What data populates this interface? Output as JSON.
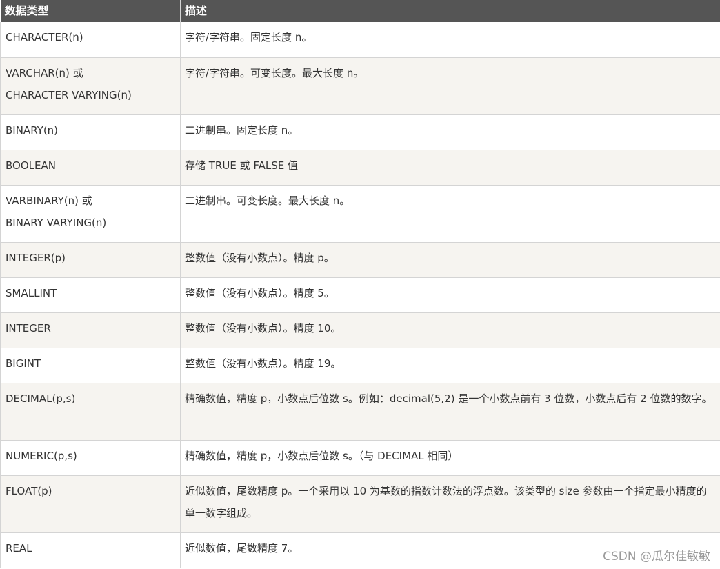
{
  "header": {
    "col_type": "数据类型",
    "col_desc": "描述"
  },
  "rows": [
    {
      "type": "CHARACTER(n)",
      "desc": "字符/字符串。固定长度 n。"
    },
    {
      "type": "VARCHAR(n) 或\nCHARACTER VARYING(n)",
      "desc": "字符/字符串。可变长度。最大长度 n。"
    },
    {
      "type": "BINARY(n)",
      "desc": "二进制串。固定长度 n。"
    },
    {
      "type": "BOOLEAN",
      "desc": "存储 TRUE 或 FALSE 值"
    },
    {
      "type": "VARBINARY(n) 或\nBINARY VARYING(n)",
      "desc": "二进制串。可变长度。最大长度 n。"
    },
    {
      "type": "INTEGER(p)",
      "desc": "整数值（没有小数点）。精度 p。"
    },
    {
      "type": "SMALLINT",
      "desc": "整数值（没有小数点）。精度 5。"
    },
    {
      "type": "INTEGER",
      "desc": "整数值（没有小数点）。精度 10。"
    },
    {
      "type": "BIGINT",
      "desc": "整数值（没有小数点）。精度 19。"
    },
    {
      "type": "DECIMAL(p,s)",
      "desc": "精确数值，精度 p，小数点后位数 s。例如：decimal(5,2) 是一个小数点前有 3 位数，小数点后有 2 位数的数字。"
    },
    {
      "type": "NUMERIC(p,s)",
      "desc": "精确数值，精度 p，小数点后位数 s。（与 DECIMAL 相同）"
    },
    {
      "type": "FLOAT(p)",
      "desc": "近似数值，尾数精度 p。一个采用以 10 为基数的指数计数法的浮点数。该类型的 size 参数由一个指定最小精度的单一数字组成。"
    },
    {
      "type": "REAL",
      "desc": "近似数值，尾数精度 7。"
    }
  ],
  "watermark": "CSDN @瓜尔佳敏敏"
}
